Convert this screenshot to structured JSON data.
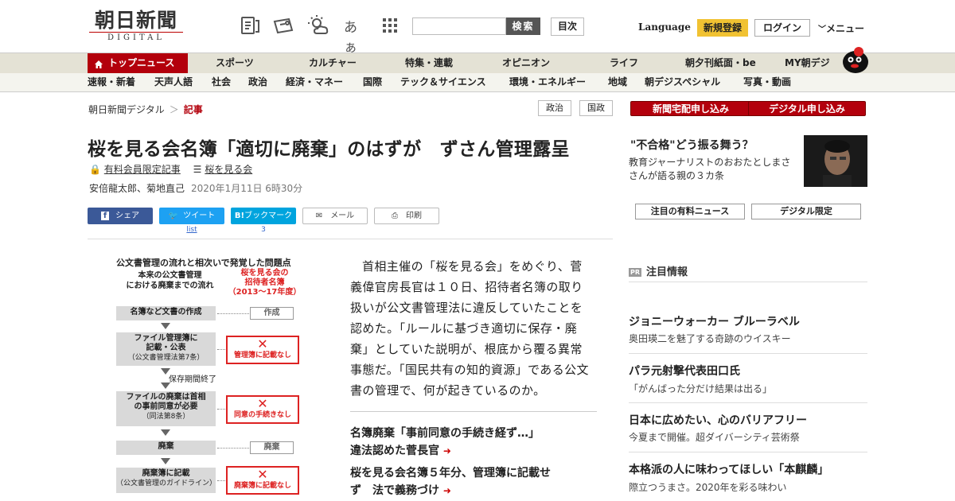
{
  "header": {
    "logo_main": "朝日新聞",
    "logo_sub": "DIGITAL",
    "font_size_icon_text": "あぁ",
    "search_button": "検索",
    "toc_button": "目次",
    "language": "Language",
    "register": "新規登録",
    "login": "ログイン",
    "menu": "メニュー"
  },
  "nav_primary": [
    "トップニュース",
    "スポーツ",
    "カルチャー",
    "特集・連載",
    "オピニオン",
    "ライフ",
    "朝夕刊紙面・be",
    "MY朝デジ"
  ],
  "nav_secondary": [
    "速報・新着",
    "天声人語",
    "社会",
    "政治",
    "経済・マネー",
    "国際",
    "テック＆サイエンス",
    "環境・エネルギー",
    "地域",
    "朝デジスペシャル",
    "写真・動画"
  ],
  "article": {
    "breadcrumb": [
      "朝日新聞デジタル",
      "記事"
    ],
    "breadcrumb_sep": "＞",
    "tags": [
      "政治",
      "国政"
    ],
    "headline": "桜を見る会名簿「適切に廃棄」のはずが　ずさん管理露呈",
    "member_label": "有料会員限定記事",
    "series_label": "桜を見る会",
    "authors": "安倍龍太郎、菊地直己",
    "date": "2020年1月11日 6時30分",
    "share": {
      "facebook": "シェア",
      "twitter": "ツイート",
      "hatena": "ブックマーク",
      "hatena_icon": "B!",
      "mail": "メール",
      "print": "印刷",
      "twitter_count": "list",
      "hatena_count": "3"
    },
    "lead": "首相主催の「桜を見る会」をめぐり、菅義偉官房長官は１０日、招待者名簿の取り扱いが公文書管理法に違反していたことを認めた。「ルールに基づき適切に保存・廃棄」としていた説明が、根底から覆る異常事態だ。「国民共有の知的資源」である公文書の管理で、何が起きているのか。",
    "related": [
      {
        "line1": "名簿廃棄「事前同意の手続き経ず…」",
        "line2": "違法認めた菅長官"
      },
      {
        "line1": "桜を見る会名簿５年分、管理簿に記載せ",
        "line2": "ず　法で義務づけ"
      }
    ]
  },
  "figure": {
    "title": "公文書管理の流れと相次いで発覚した問題点",
    "col_left": "本来の公文書管理\nにおける廃棄までの流れ",
    "col_right": "桜を見る会の\n招待者名簿\n（2013～17年度）",
    "steps": [
      {
        "main": "名簿など文書の作成",
        "sub": "",
        "status": "作成",
        "problem": false
      },
      {
        "main": "ファイル管理簿に\n記載・公表",
        "sub": "（公文書管理法第7条）",
        "status": "管理簿に記載なし",
        "problem": true
      },
      {
        "main": "ファイルの廃棄は首相\nの事前同意が必要",
        "sub": "（同法第8条）",
        "status": "同意の手続きなし",
        "problem": true
      },
      {
        "main": "廃棄",
        "sub": "",
        "status": "廃棄",
        "problem": false
      },
      {
        "main": "廃棄簿に記載",
        "sub": "（公文書管理のガイドライン）",
        "status": "廃棄簿に記載なし",
        "problem": true
      }
    ],
    "retention_label": "保存期間終了",
    "cross_mark": "✕"
  },
  "sidebar": {
    "subscribe_paper": "新聞宅配申し込み",
    "subscribe_digital": "デジタル申し込み",
    "promo_title": "\"不合格\"どう振る舞う？",
    "promo_text": "教育ジャーナリストのおおたとしまささんが語る親の３カ条",
    "link_paid": "注目の有料ニュース",
    "link_digital": "デジタル限定",
    "pr_badge": "PR",
    "pr_heading": "注目情報",
    "pr_items": [
      {
        "title": "ジョニーウォーカー ブルーラベル",
        "sub": "奥田瑛二を魅了する奇跡のウイスキー"
      },
      {
        "title": "パラ元射撃代表田口氏",
        "sub": "「がんばった分だけ結果は出る」"
      },
      {
        "title": "日本に広めたい、心のバリアフリー",
        "sub": "今夏まで開催。超ダイバーシティ芸術祭"
      },
      {
        "title": "本格派の人に味わってほしい「本麒麟」",
        "sub": "際立つうまさ。2020年を彩る味わい"
      }
    ]
  },
  "colors": {
    "brand_red": "#b3000c",
    "facebook": "#3b5998",
    "twitter": "#1da1f2",
    "hatena": "#00a4de",
    "register": "#f1c232"
  },
  "icons": [
    "newspaper-clip-icon",
    "coupon-icon",
    "weather-icon",
    "grid-menu-icon",
    "home-icon",
    "lock-icon",
    "list-icon",
    "mail-icon",
    "print-icon",
    "arrow-right-icon",
    "mascot-icon"
  ]
}
